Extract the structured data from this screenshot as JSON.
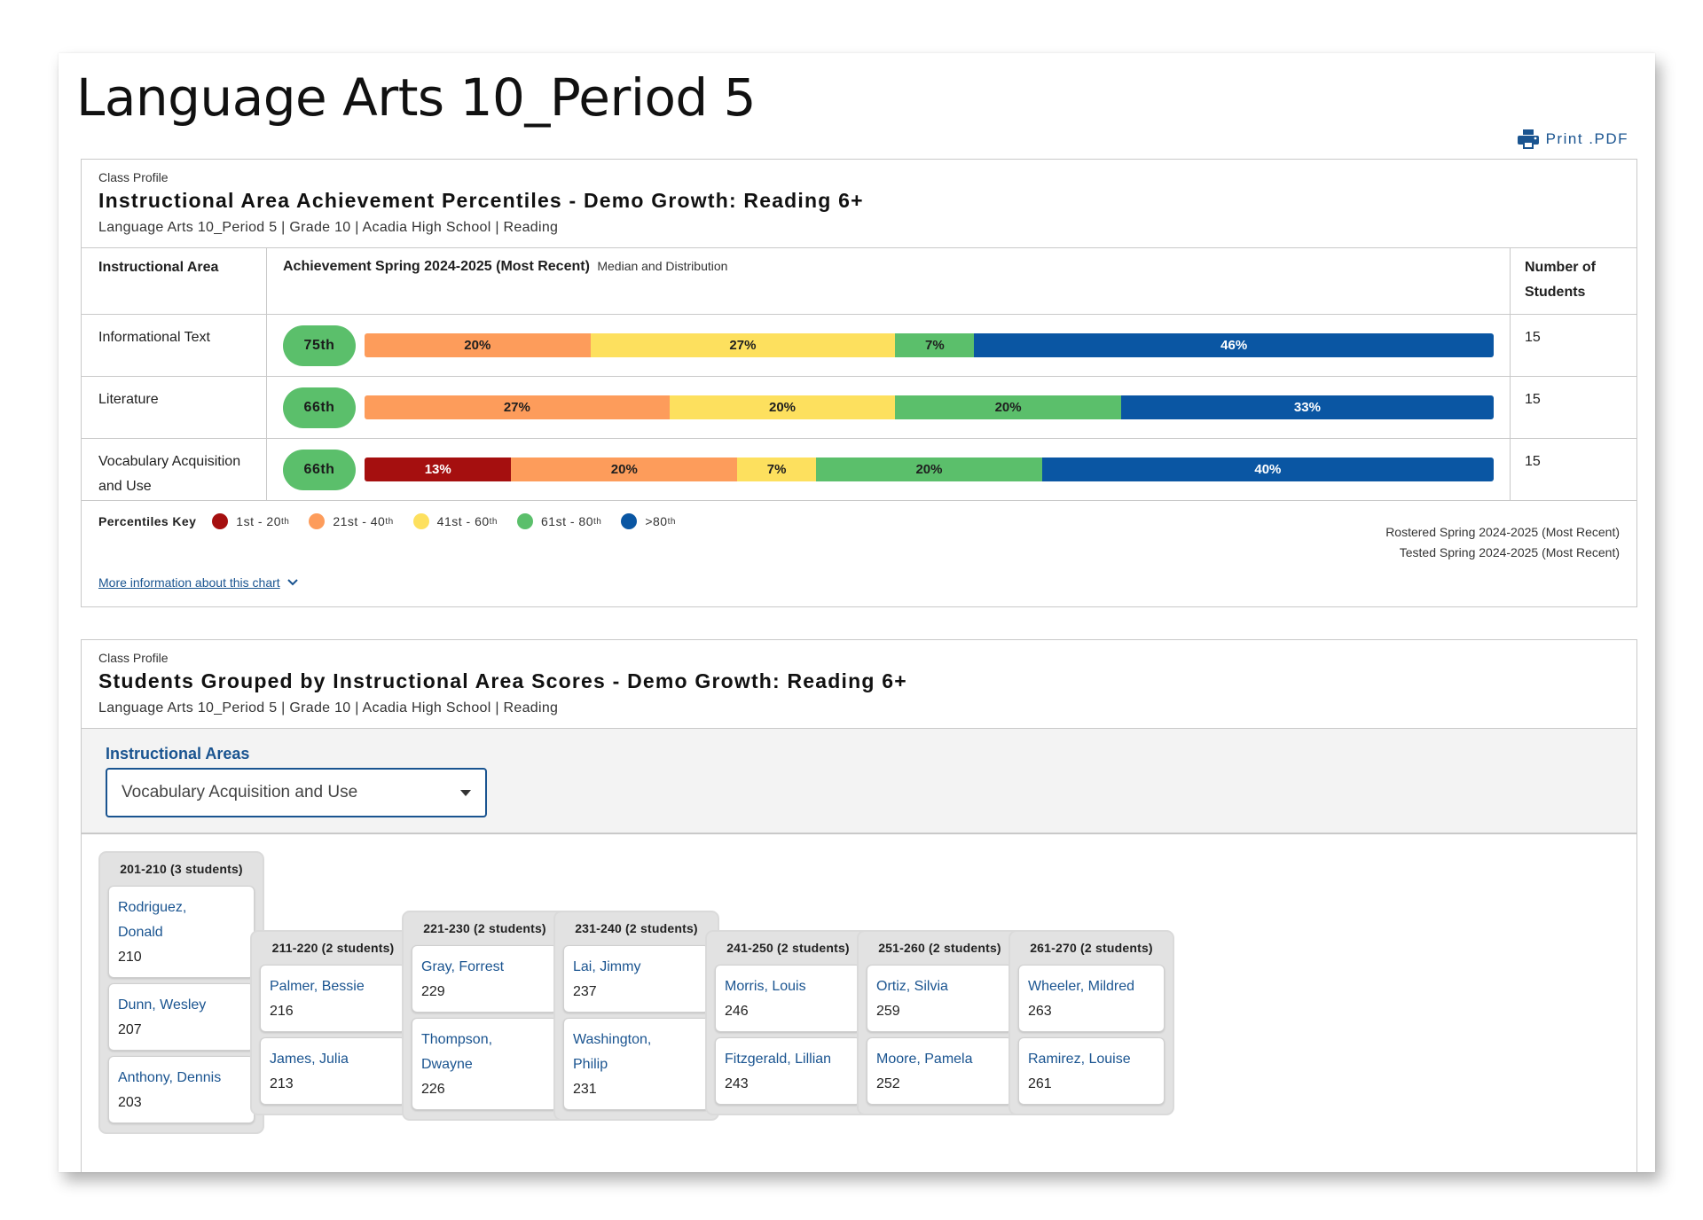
{
  "page": {
    "title": "Language Arts 10_Period 5",
    "print_label": "Print .PDF"
  },
  "card1": {
    "kicker": "Class Profile",
    "title": "Instructional Area Achievement Percentiles - Demo Growth: Reading 6+",
    "subtitle": "Language Arts 10_Period 5 | Grade 10 | Acadia High School | Reading",
    "table": {
      "col_area": "Instructional Area",
      "col_achievement": "Achievement Spring 2024-2025 (Most Recent)",
      "col_achievement_note": "Median and Distribution",
      "col_students_line1": "Number of",
      "col_students_line2": "Students",
      "rows": [
        {
          "area": "Informational Text",
          "median": "75th",
          "students": "15",
          "segments": [
            {
              "label": "20%",
              "value": 20,
              "band": "21-40"
            },
            {
              "label": "27%",
              "value": 27,
              "band": "41-60"
            },
            {
              "label": "7%",
              "value": 7,
              "band": "61-80"
            },
            {
              "label": "46%",
              "value": 46,
              "band": "80+"
            }
          ]
        },
        {
          "area": "Literature",
          "median": "66th",
          "students": "15",
          "segments": [
            {
              "label": "27%",
              "value": 27,
              "band": "21-40"
            },
            {
              "label": "20%",
              "value": 20,
              "band": "41-60"
            },
            {
              "label": "20%",
              "value": 20,
              "band": "61-80"
            },
            {
              "label": "33%",
              "value": 33,
              "band": "80+"
            }
          ]
        },
        {
          "area_line1": "Vocabulary Acquisition",
          "area_line2": "and Use",
          "median": "66th",
          "students": "15",
          "segments": [
            {
              "label": "13%",
              "value": 13,
              "band": "1-20"
            },
            {
              "label": "20%",
              "value": 20,
              "band": "21-40"
            },
            {
              "label": "7%",
              "value": 7,
              "band": "41-60"
            },
            {
              "label": "20%",
              "value": 20,
              "band": "61-80"
            },
            {
              "label": "40%",
              "value": 40,
              "band": "80+"
            }
          ]
        }
      ]
    },
    "key": {
      "label": "Percentiles Key",
      "items": [
        {
          "text": "1st - 20",
          "sup": "th",
          "color": "#a50f0f"
        },
        {
          "text": "21st - 40",
          "sup": "th",
          "color": "#fd9c5b"
        },
        {
          "text": "41st - 60",
          "sup": "th",
          "color": "#fde05e"
        },
        {
          "text": "61st - 80",
          "sup": "th",
          "color": "#5bbf6b"
        },
        {
          "text": ">80",
          "sup": "th",
          "color": "#0a56a3"
        }
      ]
    },
    "rostered": "Rostered Spring 2024-2025 (Most Recent)",
    "tested": "Tested Spring 2024-2025 (Most Recent)",
    "more_info": "More information about this chart"
  },
  "band_colors": {
    "1-20": "#a50f0f",
    "21-40": "#fd9c5b",
    "41-60": "#fde05e",
    "61-80": "#5bbf6b",
    "80+": "#0a56a3",
    "median_pill": "#5bbf6b"
  },
  "card2": {
    "kicker": "Class Profile",
    "title": "Students Grouped by Instructional Area Scores - Demo Growth: Reading 6+",
    "subtitle": "Language Arts 10_Period 5 | Grade 10 | Acadia High School | Reading",
    "filter_label": "Instructional Areas",
    "filter_value": "Vocabulary Acquisition and Use",
    "groups": [
      {
        "head": "201-210 (3 students)",
        "students": [
          {
            "name_line1": "Rodriguez,",
            "name_line2": "Donald",
            "score": "210"
          },
          {
            "name": "Dunn, Wesley",
            "score": "207"
          },
          {
            "name": "Anthony, Dennis",
            "score": "203"
          }
        ]
      },
      {
        "head": "211-220 (2 students)",
        "students": [
          {
            "name": "Palmer, Bessie",
            "score": "216"
          },
          {
            "name": "James, Julia",
            "score": "213"
          }
        ]
      },
      {
        "head": "221-230 (2 students)",
        "students": [
          {
            "name": "Gray, Forrest",
            "score": "229"
          },
          {
            "name_line1": "Thompson,",
            "name_line2": "Dwayne",
            "score": "226"
          }
        ]
      },
      {
        "head": "231-240 (2 students)",
        "students": [
          {
            "name": "Lai, Jimmy",
            "score": "237"
          },
          {
            "name_line1": "Washington,",
            "name_line2": "Philip",
            "score": "231"
          }
        ]
      },
      {
        "head": "241-250 (2 students)",
        "students": [
          {
            "name": "Morris, Louis",
            "score": "246"
          },
          {
            "name": "Fitzgerald, Lillian",
            "score": "243"
          }
        ]
      },
      {
        "head": "251-260 (2 students)",
        "students": [
          {
            "name": "Ortiz, Silvia",
            "score": "259"
          },
          {
            "name": "Moore, Pamela",
            "score": "252"
          }
        ]
      },
      {
        "head": "261-270 (2 students)",
        "students": [
          {
            "name": "Wheeler, Mildred",
            "score": "263"
          },
          {
            "name": "Ramirez, Louise",
            "score": "261"
          }
        ]
      }
    ]
  }
}
